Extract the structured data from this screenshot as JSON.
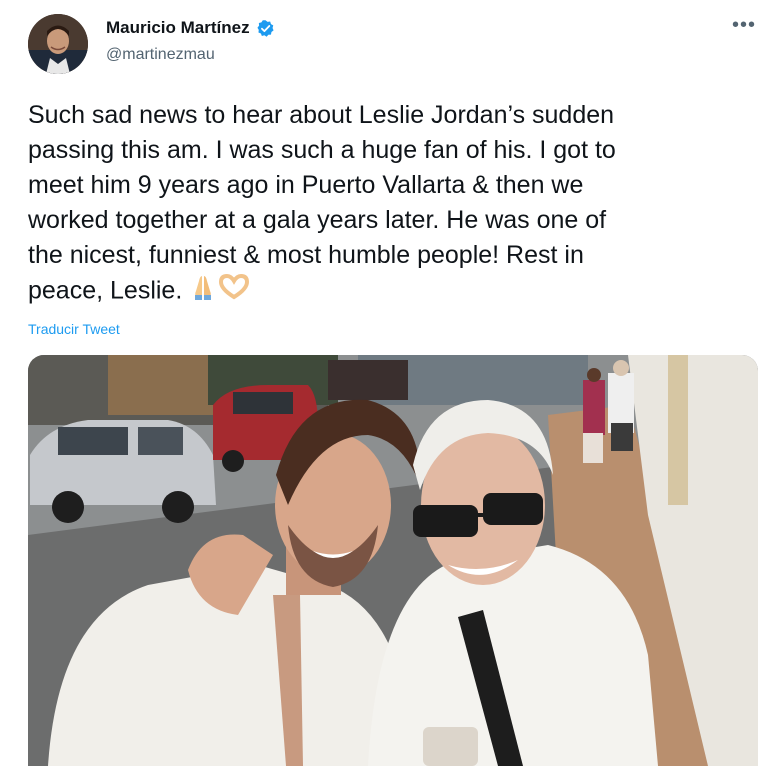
{
  "author": {
    "display_name": "Mauricio Martínez",
    "handle": "@martinezmau",
    "verified": true,
    "avatar_icon": "avatar-photo"
  },
  "menu": {
    "more_label": "•••"
  },
  "tweet": {
    "text": "Such sad news to hear about Leslie Jordan’s sudden\npassing this am. I was such a huge fan of his. I got to\nmeet him 9 years ago in Puerto Vallarta & then we\nworked together at a gala years later. He was one of\nthe nicest, funniest & most humble people! Rest in\npeace, Leslie.",
    "emojis": [
      "folded-hands-icon",
      "heart-hands-icon"
    ],
    "translate_label": "Traducir Tweet"
  },
  "media": {
    "description_icon": "photo-two-men-street"
  },
  "colors": {
    "accent": "#1d9bf0",
    "secondary_text": "#536471",
    "primary_text": "#0f1419"
  }
}
